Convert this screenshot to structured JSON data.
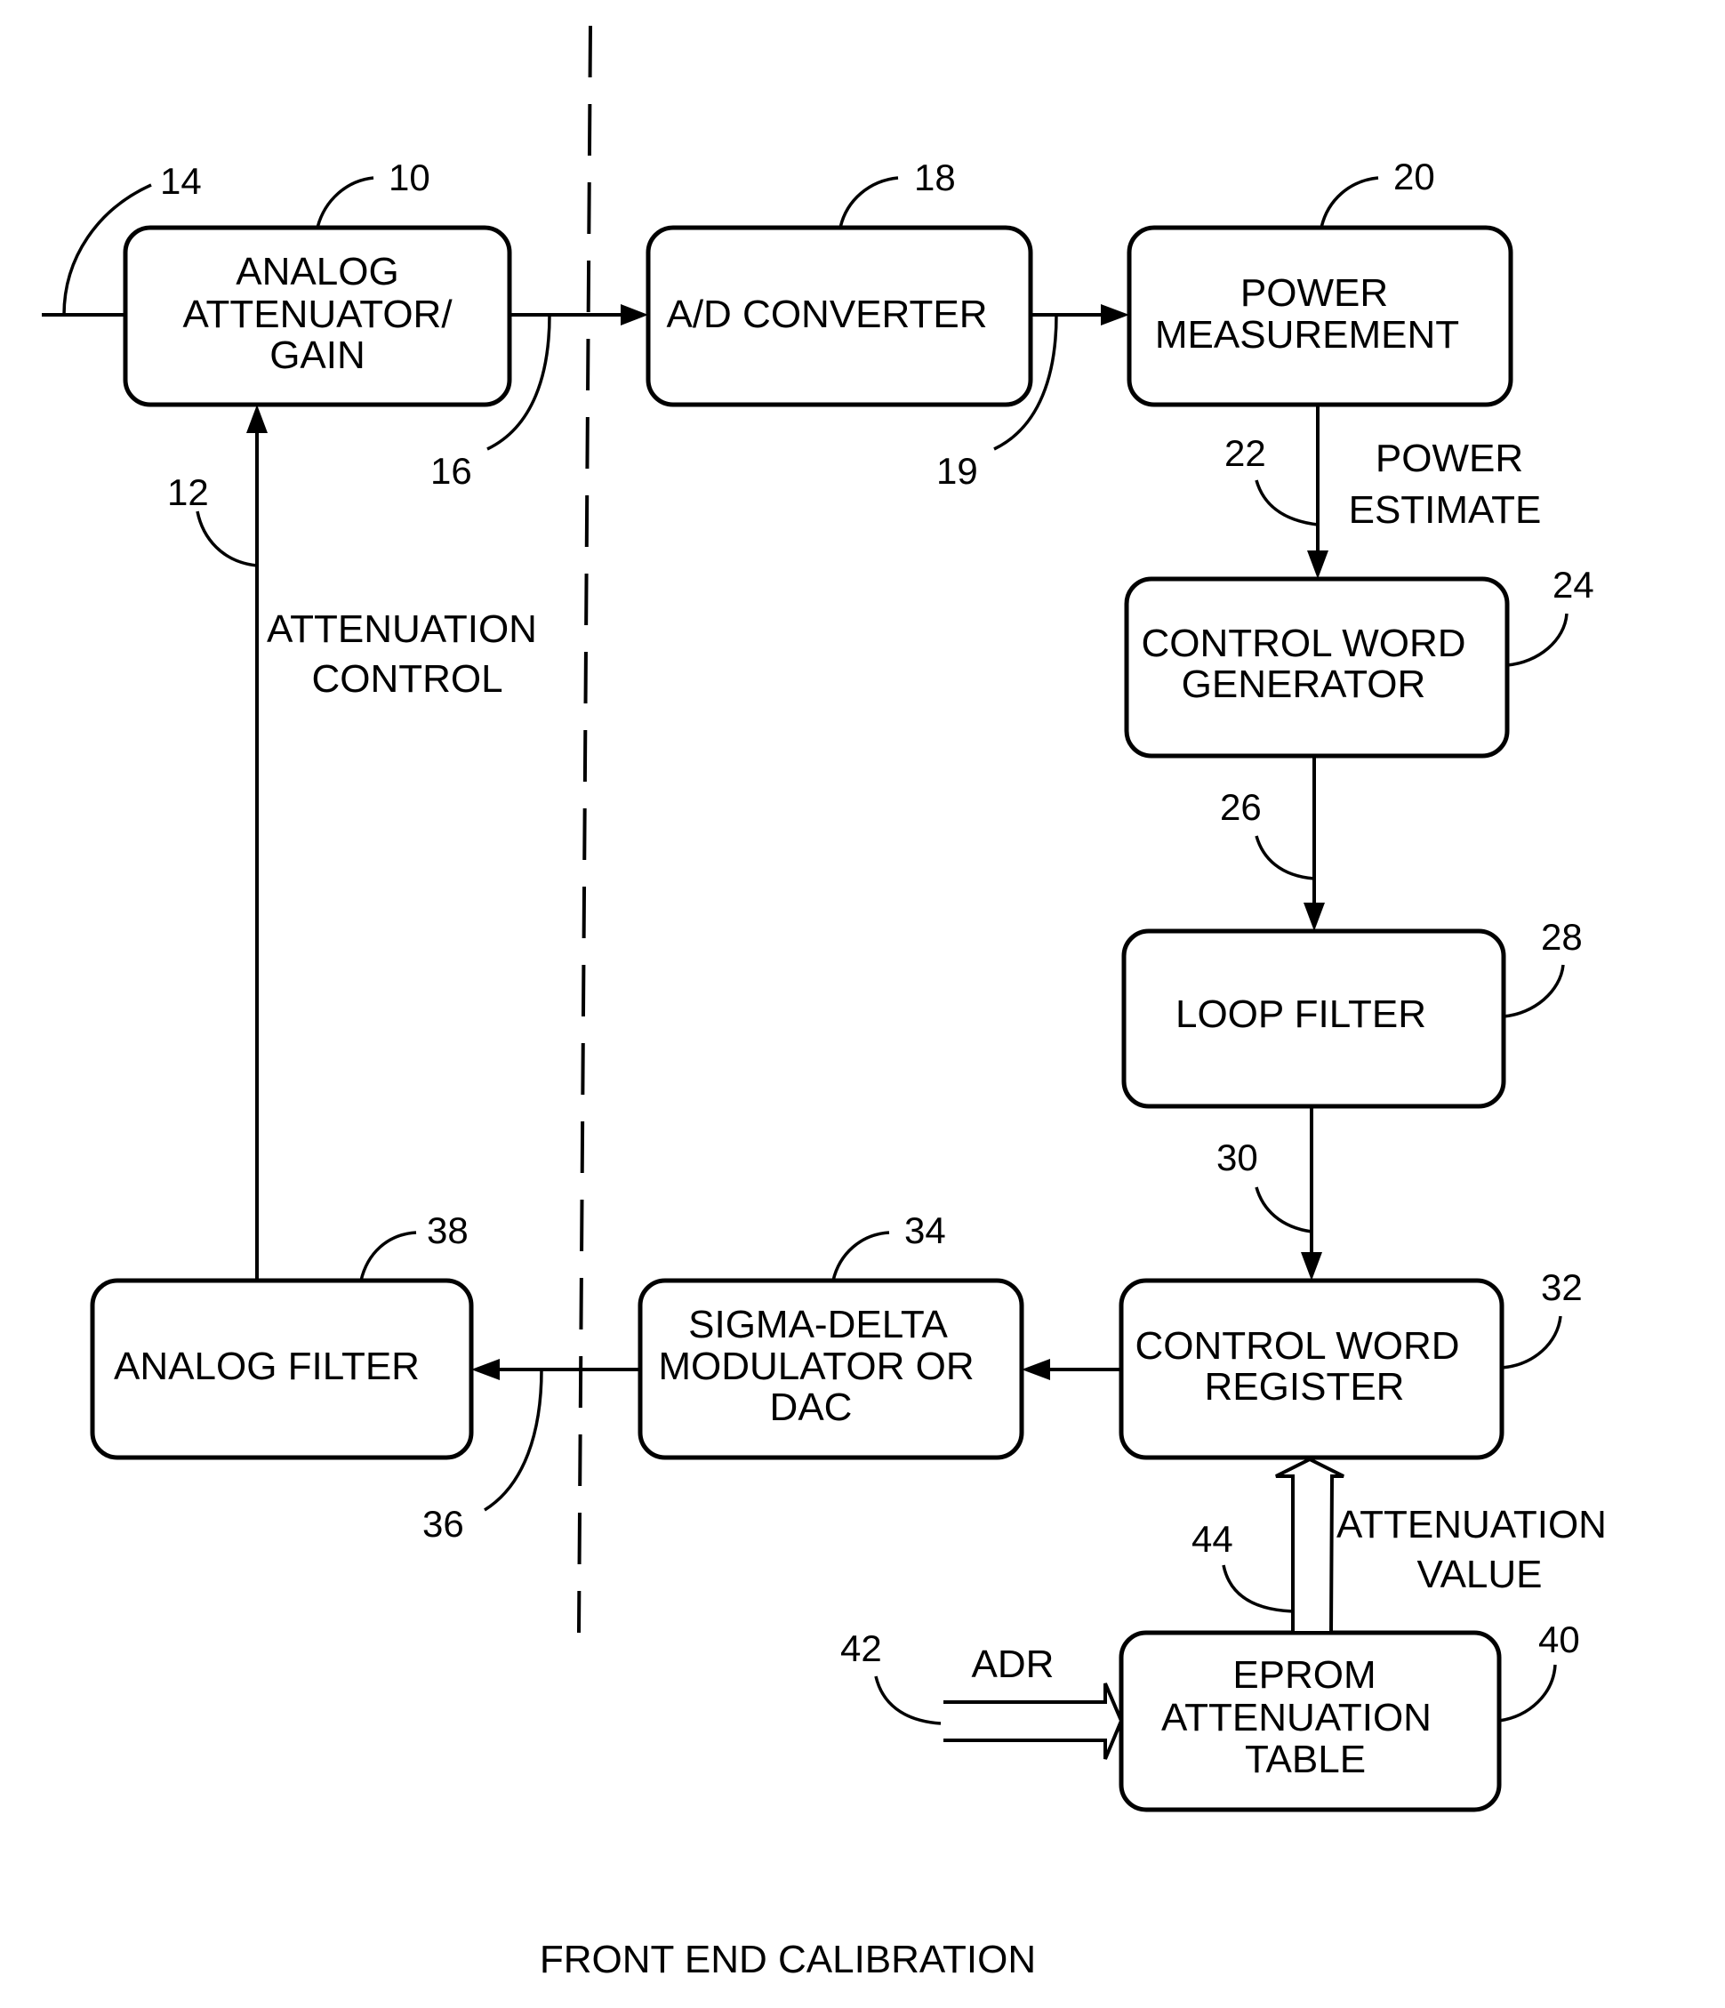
{
  "figure": {
    "caption": "FRONT END CALIBRATION"
  },
  "blocks": {
    "analog_attenuator": {
      "ref": "10",
      "lines": [
        "ANALOG",
        "ATTENUATOR/",
        "GAIN"
      ]
    },
    "ad_converter": {
      "ref": "18",
      "lines": [
        "A/D CONVERTER"
      ]
    },
    "power_measurement": {
      "ref": "20",
      "lines": [
        "POWER",
        "MEASUREMENT"
      ]
    },
    "control_word_generator": {
      "ref": "24",
      "lines": [
        "CONTROL WORD",
        "GENERATOR"
      ]
    },
    "loop_filter": {
      "ref": "28",
      "lines": [
        "LOOP FILTER"
      ]
    },
    "control_word_register": {
      "ref": "32",
      "lines": [
        "CONTROL WORD",
        "REGISTER"
      ]
    },
    "sigma_delta": {
      "ref": "34",
      "lines": [
        "SIGMA-DELTA",
        "MODULATOR OR",
        "DAC"
      ]
    },
    "analog_filter": {
      "ref": "38",
      "lines": [
        "ANALOG FILTER"
      ]
    },
    "eprom_table": {
      "ref": "40",
      "lines": [
        "EPROM",
        "ATTENUATION",
        "TABLE"
      ]
    }
  },
  "signals": {
    "input": {
      "ref": "14"
    },
    "attenuator_out": {
      "ref": "16"
    },
    "adc_out": {
      "ref": "19"
    },
    "power_estimate": {
      "ref": "22",
      "lines": [
        "POWER",
        "ESTIMATE"
      ]
    },
    "control_word": {
      "ref": "26"
    },
    "filtered_word": {
      "ref": "30"
    },
    "modulator_out": {
      "ref": "36"
    },
    "attenuation_control": {
      "ref": "12",
      "lines": [
        "ATTENUATION",
        "CONTROL"
      ]
    },
    "attenuation_value": {
      "ref": "44",
      "lines": [
        "ATTENUATION",
        "VALUE"
      ]
    },
    "address": {
      "ref": "42",
      "label": "ADR"
    }
  }
}
